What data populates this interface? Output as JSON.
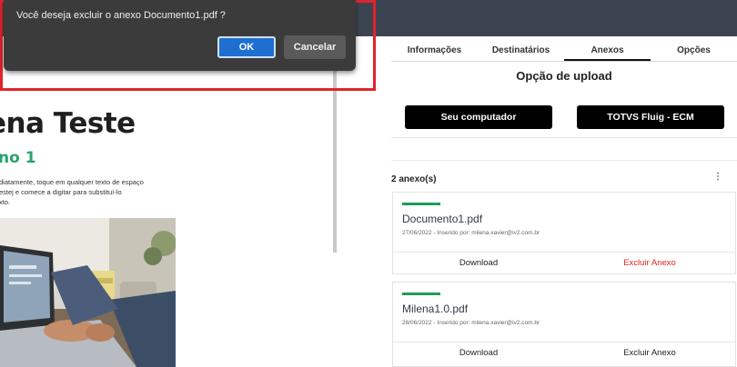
{
  "dialog": {
    "message": "Você deseja excluir o anexo Documento1.pdf ?",
    "ok_label": "OK",
    "cancel_label": "Cancelar"
  },
  "document": {
    "title": "ena Teste",
    "subtitle": "no 1",
    "body_lines": [
      "diatamente, toque em qualquer texto de espaço",
      "estej e comece a digitar para substituí-lo",
      "xto."
    ]
  },
  "tabs": [
    {
      "label": "Informações"
    },
    {
      "label": "Destinatários"
    },
    {
      "label": "Anexos"
    },
    {
      "label": "Opções"
    }
  ],
  "upload": {
    "title": "Opção de upload",
    "button_computer": "Seu computador",
    "button_fluig": "TOTVS Fluig - ECM"
  },
  "attachments": {
    "count_label": "2 anexo(s)",
    "items": [
      {
        "name": "Documento1.pdf",
        "meta": "27/06/2022 - Inserido por: milena.xavier@iv2.com.br",
        "download_label": "Download",
        "delete_label": "Excluir Anexo"
      },
      {
        "name": "Milena1.0.pdf",
        "meta": "28/06/2022 - Inserido por: milena.xavier@iv2.com.br",
        "download_label": "Download",
        "delete_label": "Excluir Anexo"
      }
    ]
  },
  "colors": {
    "accent_green": "#1f9d57",
    "danger_red": "#e02424",
    "highlight_frame": "#e2232a",
    "ok_blue": "#1f6fd1"
  }
}
